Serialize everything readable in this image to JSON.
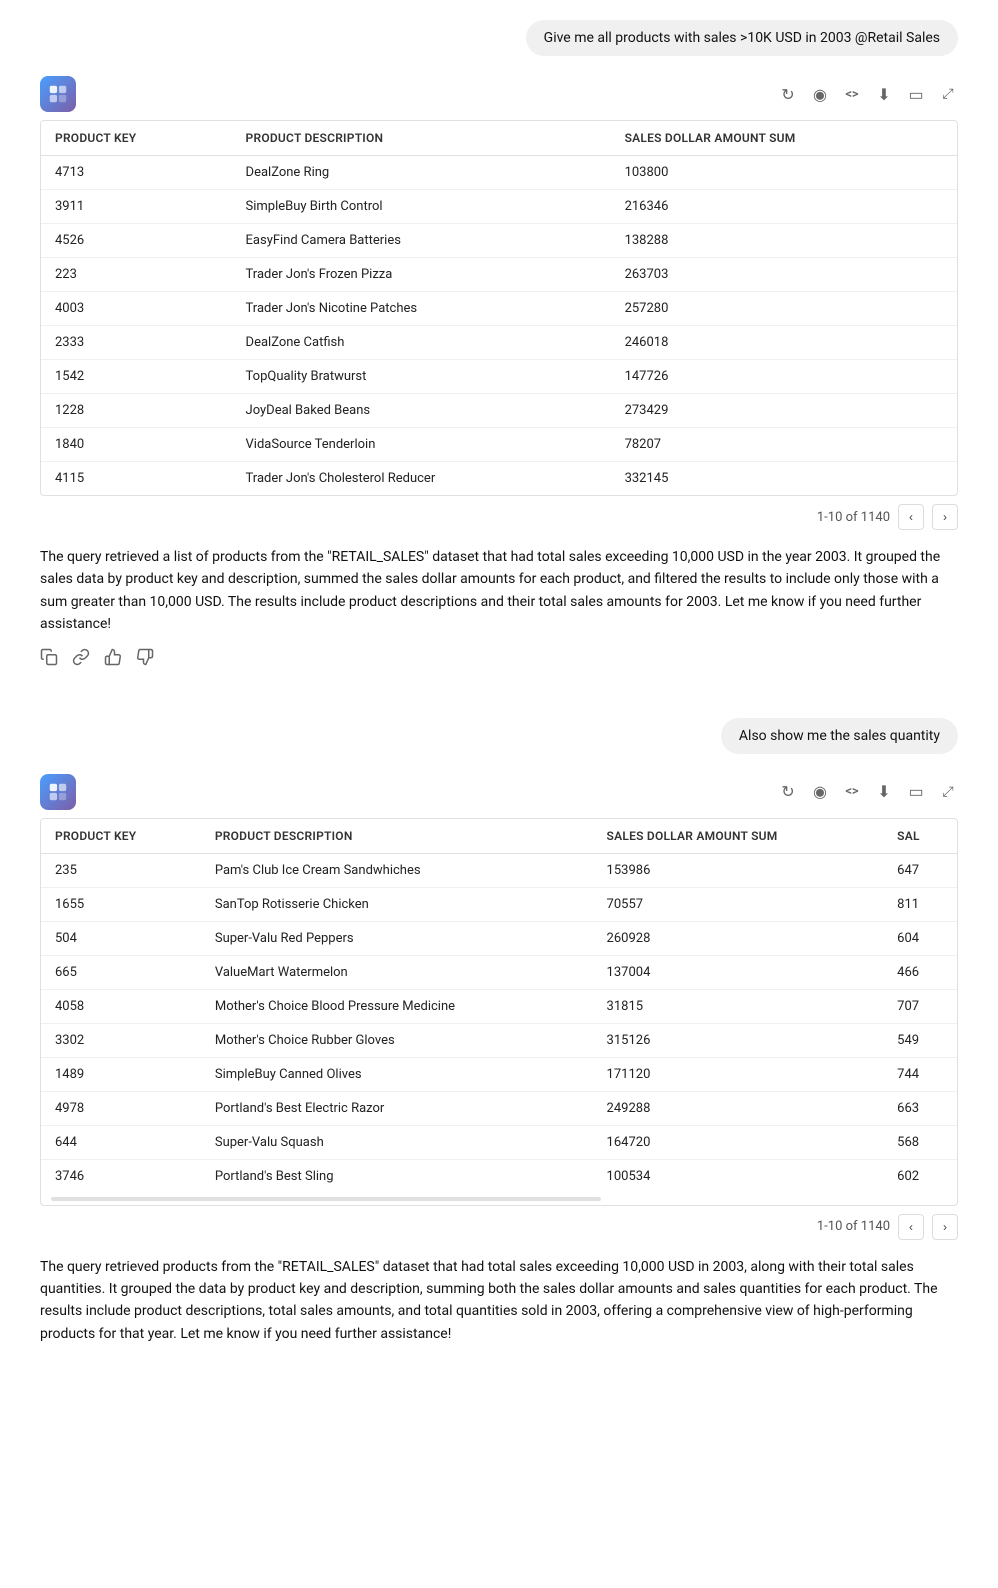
{
  "messages": [
    {
      "id": "user1",
      "type": "user",
      "text": "Give me all products with sales >10K USD in 2003 @Retail Sales"
    },
    {
      "id": "ai1",
      "type": "ai",
      "table": {
        "columns": [
          "PRODUCT KEY",
          "PRODUCT DESCRIPTION",
          "SALES DOLLAR AMOUNT SUM"
        ],
        "rows": [
          [
            "4713",
            "DealZone Ring",
            "103800"
          ],
          [
            "3911",
            "SimpleBuy Birth Control",
            "216346"
          ],
          [
            "4526",
            "EasyFind Camera Batteries",
            "138288"
          ],
          [
            "223",
            "Trader Jon's Frozen Pizza",
            "263703"
          ],
          [
            "4003",
            "Trader Jon's Nicotine Patches",
            "257280"
          ],
          [
            "2333",
            "DealZone Catfish",
            "246018"
          ],
          [
            "1542",
            "TopQuality Bratwurst",
            "147726"
          ],
          [
            "1228",
            "JoyDeal Baked Beans",
            "273429"
          ],
          [
            "1840",
            "VidaSource Tenderloin",
            "78207"
          ],
          [
            "4115",
            "Trader Jon's Cholesterol Reducer",
            "332145"
          ]
        ],
        "pagination": "1-10 of 1140"
      },
      "text": "The query retrieved a list of products from the \"RETAIL_SALES\" dataset that had total sales exceeding 10,000 USD in the year 2003. It grouped the sales data by product key and description, summed the sales dollar amounts for each product, and filtered the results to include only those with a sum greater than 10,000 USD. The results include product descriptions and their total sales amounts for 2003. Let me know if you need further assistance!"
    },
    {
      "id": "user2",
      "type": "user",
      "text": "Also show me the sales quantity"
    },
    {
      "id": "ai2",
      "type": "ai",
      "table": {
        "columns": [
          "PRODUCT KEY",
          "PRODUCT DESCRIPTION",
          "SALES DOLLAR AMOUNT SUM",
          "SAL"
        ],
        "rows": [
          [
            "235",
            "Pam's Club Ice Cream Sandwhiches",
            "153986",
            "647"
          ],
          [
            "1655",
            "SanTop Rotisserie Chicken",
            "70557",
            "811"
          ],
          [
            "504",
            "Super-Valu Red Peppers",
            "260928",
            "604"
          ],
          [
            "665",
            "ValueMart Watermelon",
            "137004",
            "466"
          ],
          [
            "4058",
            "Mother's Choice Blood Pressure Medicine",
            "31815",
            "707"
          ],
          [
            "3302",
            "Mother's Choice Rubber Gloves",
            "315126",
            "549"
          ],
          [
            "1489",
            "SimpleBuy Canned Olives",
            "171120",
            "744"
          ],
          [
            "4978",
            "Portland's Best Electric Razor",
            "249288",
            "663"
          ],
          [
            "644",
            "Super-Valu Squash",
            "164720",
            "568"
          ],
          [
            "3746",
            "Portland's Best Sling",
            "100534",
            "602"
          ]
        ],
        "pagination": "1-10 of 1140"
      },
      "text": "The query retrieved products from the \"RETAIL_SALES\" dataset that had total sales exceeding 10,000 USD in 2003, along with their total sales quantities. It grouped the data by product key and description, summing both the sales dollar amounts and sales quantities for each product. The results include product descriptions, total sales amounts, and total quantities sold in 2003, offering a comprehensive view of high-performing products for that year. Let me know if you need further assistance!"
    }
  ],
  "toolbar": {
    "refresh_icon": "↻",
    "eye_icon": "◎",
    "code_icon": "<>",
    "download_icon": "↓",
    "expand_icon": "⊡",
    "fullscreen_icon": "⤢"
  },
  "action_icons": {
    "copy": "⎘",
    "link": "🔗",
    "thumbup": "👍",
    "thumbdown": "👎"
  }
}
